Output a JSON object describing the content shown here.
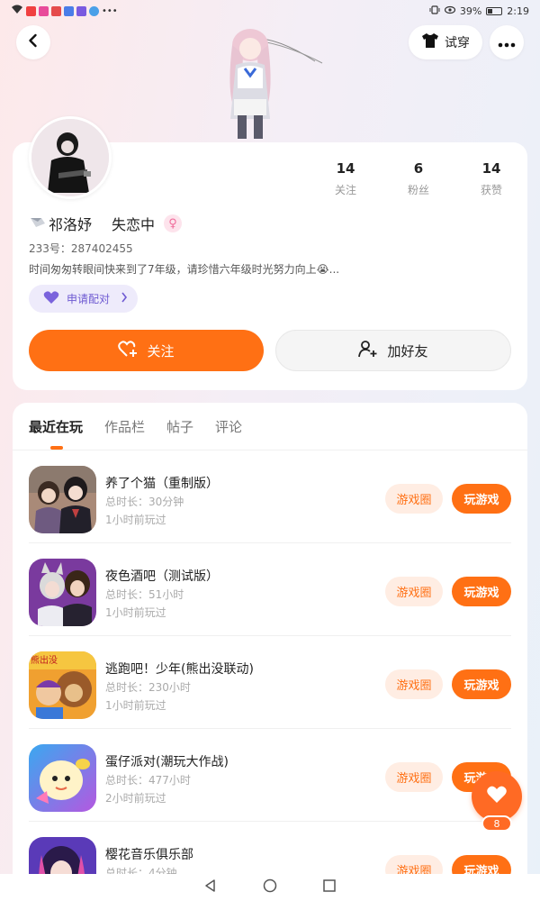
{
  "status_bar": {
    "battery": "39%",
    "time": "2:19",
    "battery_level": 0.39
  },
  "header": {
    "try_on_label": "试穿"
  },
  "profile": {
    "stats": [
      {
        "value": "14",
        "label": "关注"
      },
      {
        "value": "6",
        "label": "粉丝"
      },
      {
        "value": "14",
        "label": "获赞"
      }
    ],
    "name": "祁洛妤",
    "mood": "失恋中",
    "uid": "233号：287402455",
    "bio": "时间匆匆转眼间快来到了7年级，请珍惜六年级时光努力向上😭...",
    "pair_label": "申请配对",
    "follow_label": "关注",
    "add_friend_label": "加好友"
  },
  "tabs": [
    "最近在玩",
    "作品栏",
    "帖子",
    "评论"
  ],
  "games": [
    {
      "title": "养了个猫（重制版）",
      "duration": "总时长：30分钟",
      "last_played": "1小时前玩过"
    },
    {
      "title": "夜色酒吧（测试版）",
      "duration": "总时长：51小时",
      "last_played": "1小时前玩过"
    },
    {
      "title": "逃跑吧！少年(熊出没联动)",
      "duration": "总时长：230小时",
      "last_played": "1小时前玩过"
    },
    {
      "title": "蛋仔派对(潮玩大作战)",
      "duration": "总时长：477小时",
      "last_played": "2小时前玩过"
    },
    {
      "title": "樱花音乐俱乐部",
      "duration": "总时长：4分钟",
      "last_played": ""
    }
  ],
  "game_buttons": {
    "circle": "游戏圈",
    "play": "玩游戏"
  },
  "game_icon_badge": "熊出没",
  "fab": {
    "count": "8"
  },
  "colors": {
    "accent": "#ff7014",
    "pair": "#6e5ad2"
  }
}
